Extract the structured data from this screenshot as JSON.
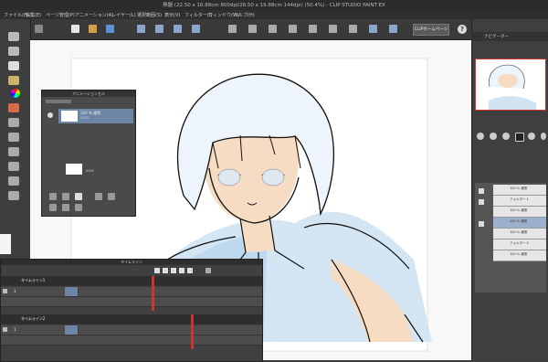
{
  "window": {
    "title": "無題 (22.50 x 16.88cm 800dpi/26.50 x 19.88cm 144dpi) (50.4%) - CLIP STUDIO PAINT EX"
  },
  "menu": {
    "items": [
      "ファイル(F)",
      "編集(E)",
      "ページ管理(P)",
      "アニメーション(A)",
      "レイヤー(L)",
      "選択範囲(S)",
      "表示(V)",
      "フィルター(I)",
      "ウィンドウ(W)",
      "ヘルプ(H)"
    ]
  },
  "command_bar": {
    "clip_home_label": "CLIPホームページ",
    "help_label": "?"
  },
  "layer_popup": {
    "title": "アニメーションセル",
    "rows": [
      {
        "name": "100 % 通常",
        "sub": "0000"
      },
      {
        "name": "",
        "sub": "0000"
      }
    ]
  },
  "timeline": {
    "title": "タイムライン",
    "tracks": [
      {
        "name": "タイムライン1",
        "cell": "1"
      },
      {
        "name": "タイムライン2",
        "cell": "1"
      }
    ]
  },
  "right_panel": {
    "navigator_title": "ナビゲーター",
    "layers": [
      "100 % 通常",
      "フォルダー 1",
      "100 % 通常",
      "100 % 通常",
      "100 % 通常",
      "フォルダー 2",
      "100 % 通常"
    ]
  },
  "colors": {
    "accent": "#cc3333",
    "panel": "#3c3c3c",
    "skin": "#f3d2b3",
    "shirt": "#bcd9ef",
    "lines": "#111111"
  }
}
